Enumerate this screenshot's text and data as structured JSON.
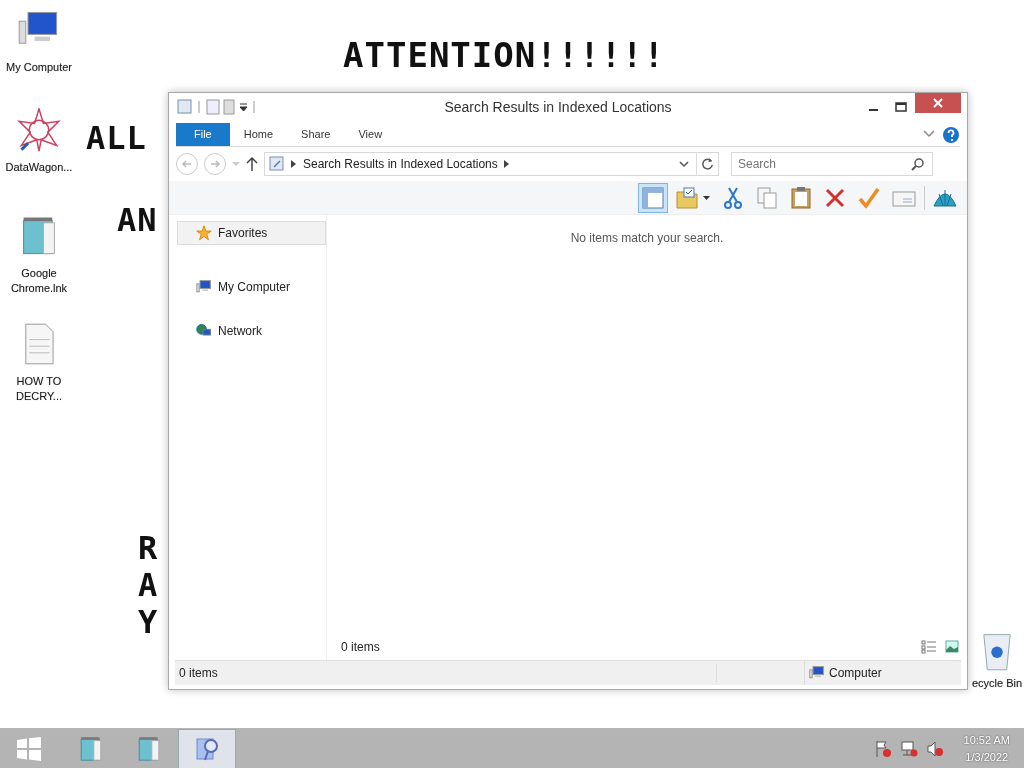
{
  "desktop": {
    "wallpaper_texts": [
      {
        "text": "ATTENTION!!!!!!",
        "kind": "heading"
      },
      {
        "text": "ALL",
        "kind": "line1"
      },
      {
        "text": "AN",
        "kind": "line2"
      },
      {
        "text": "R",
        "kind": "line3"
      },
      {
        "text": "A",
        "kind": "line4"
      },
      {
        "text": "Y",
        "kind": "line5"
      }
    ],
    "icons": [
      {
        "label": "My Computer",
        "kind": "computer"
      },
      {
        "label": "DataWagon...",
        "kind": "star"
      },
      {
        "label": "Google Chrome.lnk",
        "kind": "notepad"
      },
      {
        "label": "HOW TO DECRY...",
        "kind": "document"
      },
      {
        "label": "ecycle Bin",
        "kind": "bin"
      }
    ]
  },
  "window": {
    "title": "Search Results in Indexed Locations",
    "ribbon_tabs": [
      {
        "label": "File",
        "kind": "file",
        "selected": false
      },
      {
        "label": "Home",
        "kind": "tab",
        "selected": false
      },
      {
        "label": "Share",
        "kind": "tab",
        "selected": false
      },
      {
        "label": "View",
        "kind": "tab",
        "selected": false
      }
    ],
    "address": "Search Results in Indexed Locations",
    "search": {
      "placeholder": "Search"
    },
    "toolbar": [
      {
        "kind": "preview",
        "selected": true
      },
      {
        "kind": "folder",
        "selected": false
      },
      {
        "kind": "cut",
        "selected": false
      },
      {
        "kind": "copy",
        "selected": false
      },
      {
        "kind": "paste",
        "selected": false
      },
      {
        "kind": "delete",
        "selected": false
      },
      {
        "kind": "check",
        "selected": false
      },
      {
        "kind": "card",
        "selected": false
      },
      {
        "kind": "shell",
        "selected": false
      }
    ],
    "navigation": [
      {
        "label": "Favorites",
        "kind": "star",
        "selected": true
      },
      {
        "label": "My Computer",
        "kind": "computer",
        "selected": false
      },
      {
        "label": "Network",
        "kind": "network",
        "selected": false
      }
    ],
    "empty_message": "No items match your search.",
    "item_count": "0 items",
    "status_bar": {
      "count": "0 items",
      "location": "Computer"
    }
  },
  "taskbar": {
    "buttons": [
      {
        "kind": "notepad",
        "selected": false
      },
      {
        "kind": "notepad",
        "selected": false
      },
      {
        "kind": "search",
        "selected": true
      }
    ],
    "clock": {
      "time": "10:52 AM",
      "date": "1/3/2022"
    }
  }
}
